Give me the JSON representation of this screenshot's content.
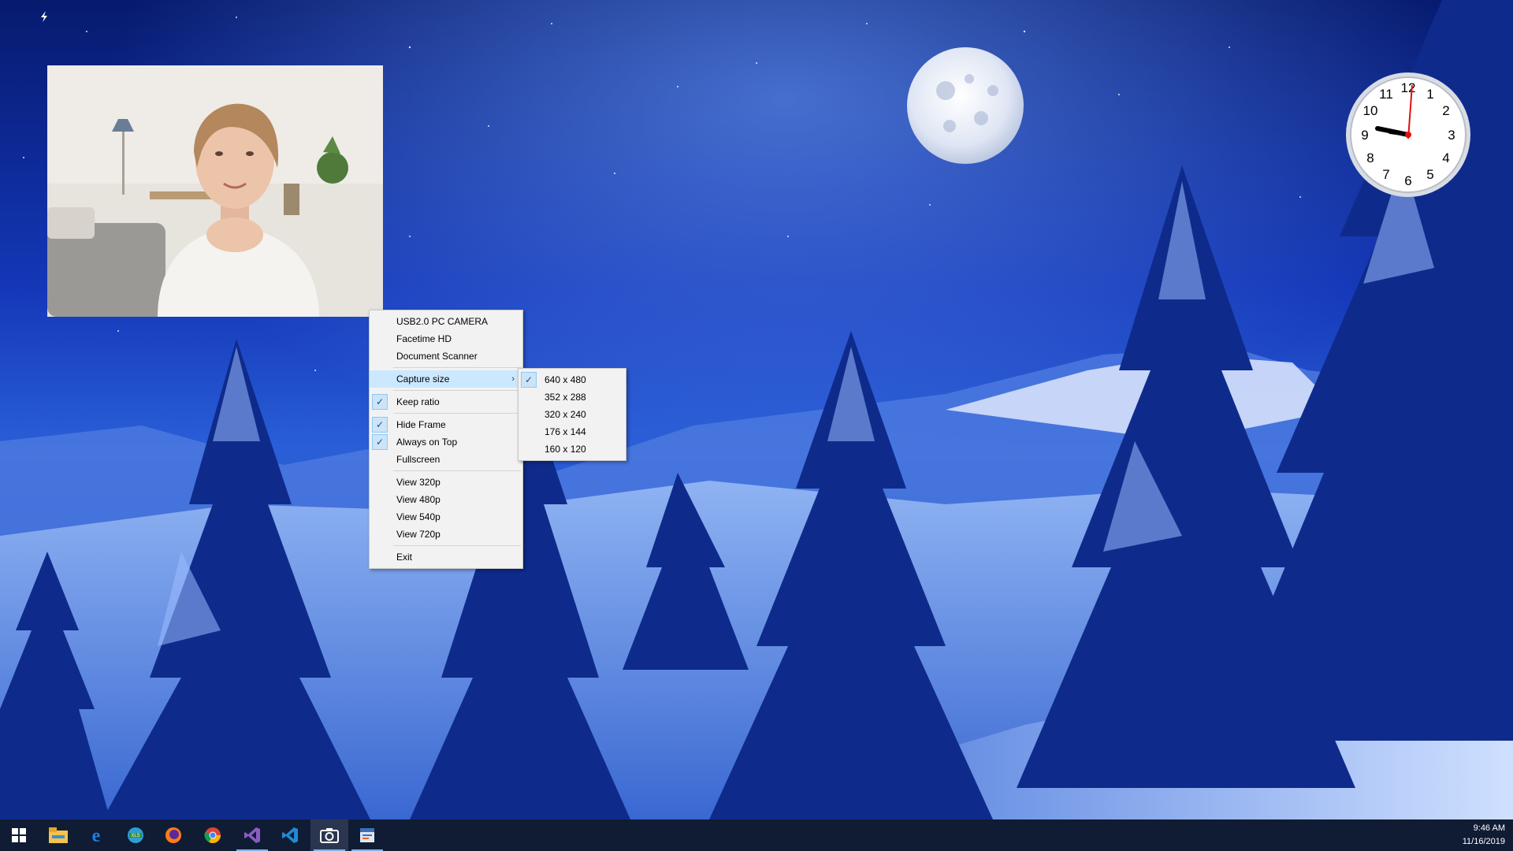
{
  "camera_menu": {
    "sources": [
      {
        "label": "USB2.0 PC CAMERA"
      },
      {
        "label": "Facetime HD"
      },
      {
        "label": "Document Scanner"
      }
    ],
    "capture_size": {
      "label": "Capture size",
      "highlighted": true
    },
    "keep_ratio": {
      "label": "Keep ratio",
      "checked": true
    },
    "window_options": [
      {
        "label": "Hide Frame",
        "checked": true
      },
      {
        "label": "Always on Top",
        "checked": true
      },
      {
        "label": "Fullscreen",
        "checked": false
      }
    ],
    "view_sizes": [
      {
        "label": "View 320p"
      },
      {
        "label": "View 480p"
      },
      {
        "label": "View 540p"
      },
      {
        "label": "View 720p"
      }
    ],
    "exit": {
      "label": "Exit"
    }
  },
  "capture_size_submenu": {
    "options": [
      {
        "label": "640 x 480",
        "checked": true
      },
      {
        "label": "352 x 288",
        "checked": false
      },
      {
        "label": "320 x 240",
        "checked": false
      },
      {
        "label": "176 x 144",
        "checked": false
      },
      {
        "label": "160 x 120",
        "checked": false
      }
    ]
  },
  "clock": {
    "numerals": [
      "12",
      "1",
      "2",
      "3",
      "4",
      "5",
      "6",
      "7",
      "8",
      "9",
      "10",
      "11"
    ],
    "second_hand_color": "#e11010"
  },
  "taskbar": {
    "icons": [
      "windows-start-icon",
      "file-explorer-icon",
      "edge-icon",
      "ie-icon",
      "firefox-icon",
      "chrome-icon",
      "visual-studio-icon",
      "vscode-icon",
      "camera-app-icon",
      "control-panel-icon"
    ],
    "time": "9:46 AM",
    "date": "11/16/2019"
  },
  "colors": {
    "menu_highlight": "#cce8ff",
    "check_box": "#cce4f7",
    "taskbar": "#101c33"
  }
}
